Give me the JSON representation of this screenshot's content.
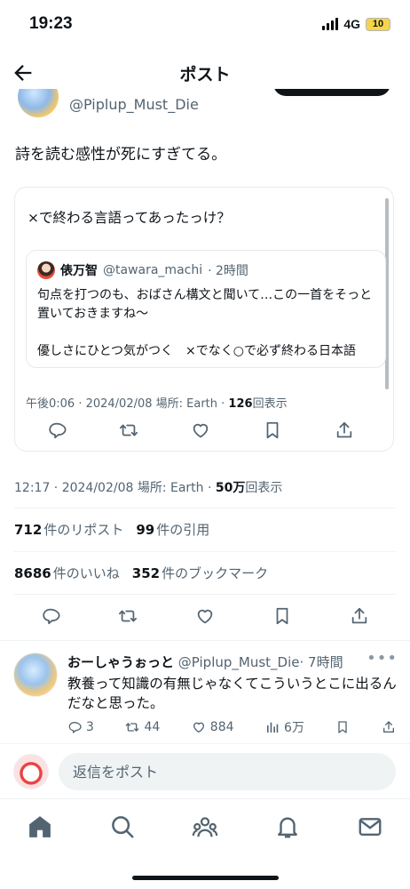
{
  "status_bar": {
    "time": "19:23",
    "network": "4G",
    "battery": "10"
  },
  "header": {
    "title": "ポスト",
    "back_icon": "arrow-left-icon"
  },
  "post": {
    "author_handle": "@Piplup_Must_Die",
    "text": "詩を読む感性が死にすぎてる。",
    "meta_time": "12:17 · 2024/02/08 場所: Earth · ",
    "views": "50万",
    "views_suffix": "回表示"
  },
  "embedded_post": {
    "text": "×で終わる言語ってあったっけ？",
    "quote": {
      "name": "俵万智",
      "handle": "@tawara_machi",
      "age": "· 2時間",
      "line1": "句点を打つのも、おばさん構文と聞いて…この一首をそっと置いておきますね〜",
      "line2": "優しさにひとつ気がつく　×でなく○で必ず終わる日本語"
    },
    "meta_time": "午後0:06 · 2024/02/08 場所: Earth · ",
    "views": "126",
    "views_suffix": "回表示"
  },
  "stats": {
    "reposts_count": "712",
    "reposts_label": "件のリポスト",
    "quotes_count": "99",
    "quotes_label": "件の引用",
    "likes_count": "8686",
    "likes_label": "件のいいね",
    "bookmarks_count": "352",
    "bookmarks_label": "件のブックマーク"
  },
  "reply": {
    "name": "おーしゃうぉっと",
    "handle": "@Piplup_Must_Die",
    "age": "· 7時間",
    "more": "•••",
    "text": "教養って知識の有無じゃなくてこういうとこに出るんだなと思った。",
    "replies": "3",
    "reposts": "44",
    "likes": "884",
    "views": "6万"
  },
  "composer": {
    "placeholder": "返信をポスト"
  },
  "tabbar": {
    "items": [
      "home-icon",
      "search-icon",
      "communities-icon",
      "notifications-icon",
      "messages-icon"
    ]
  },
  "colors": {
    "text": "#0f1419",
    "muted": "#536471",
    "divider": "#eff3f4",
    "battery": "#f4d54a"
  }
}
